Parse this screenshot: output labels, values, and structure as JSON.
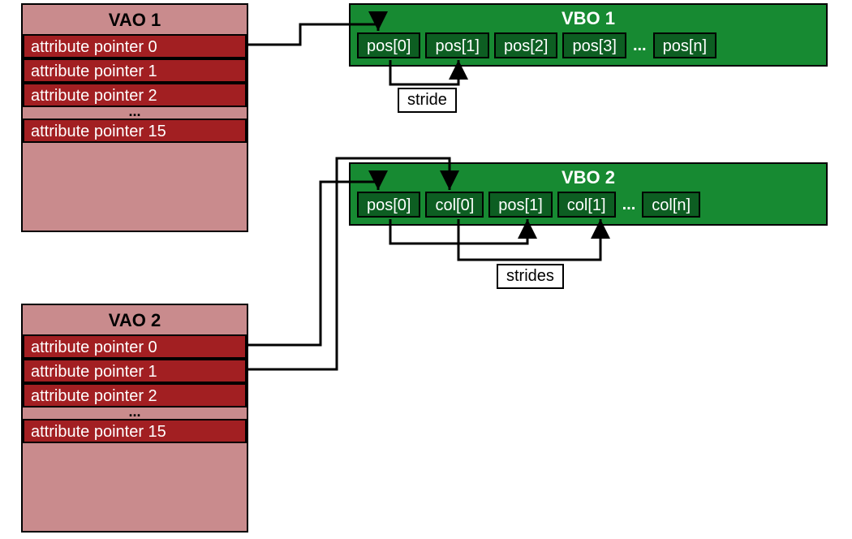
{
  "vao1": {
    "title": "VAO 1",
    "attrs": [
      "attribute pointer 0",
      "attribute pointer 1",
      "attribute pointer 2"
    ],
    "ellipsis": "...",
    "attr_last": "attribute pointer 15"
  },
  "vao2": {
    "title": "VAO 2",
    "attrs": [
      "attribute pointer 0",
      "attribute pointer 1",
      "attribute pointer 2"
    ],
    "ellipsis": "...",
    "attr_last": "attribute pointer 15"
  },
  "vbo1": {
    "title": "VBO 1",
    "cells": [
      "pos[0]",
      "pos[1]",
      "pos[2]",
      "pos[3]"
    ],
    "ellipsis": "...",
    "cell_last": "pos[n]"
  },
  "vbo2": {
    "title": "VBO 2",
    "cells": [
      "pos[0]",
      "col[0]",
      "pos[1]",
      "col[1]"
    ],
    "ellipsis": "...",
    "cell_last": "col[n]"
  },
  "labels": {
    "stride": "stride",
    "strides": "strides"
  }
}
